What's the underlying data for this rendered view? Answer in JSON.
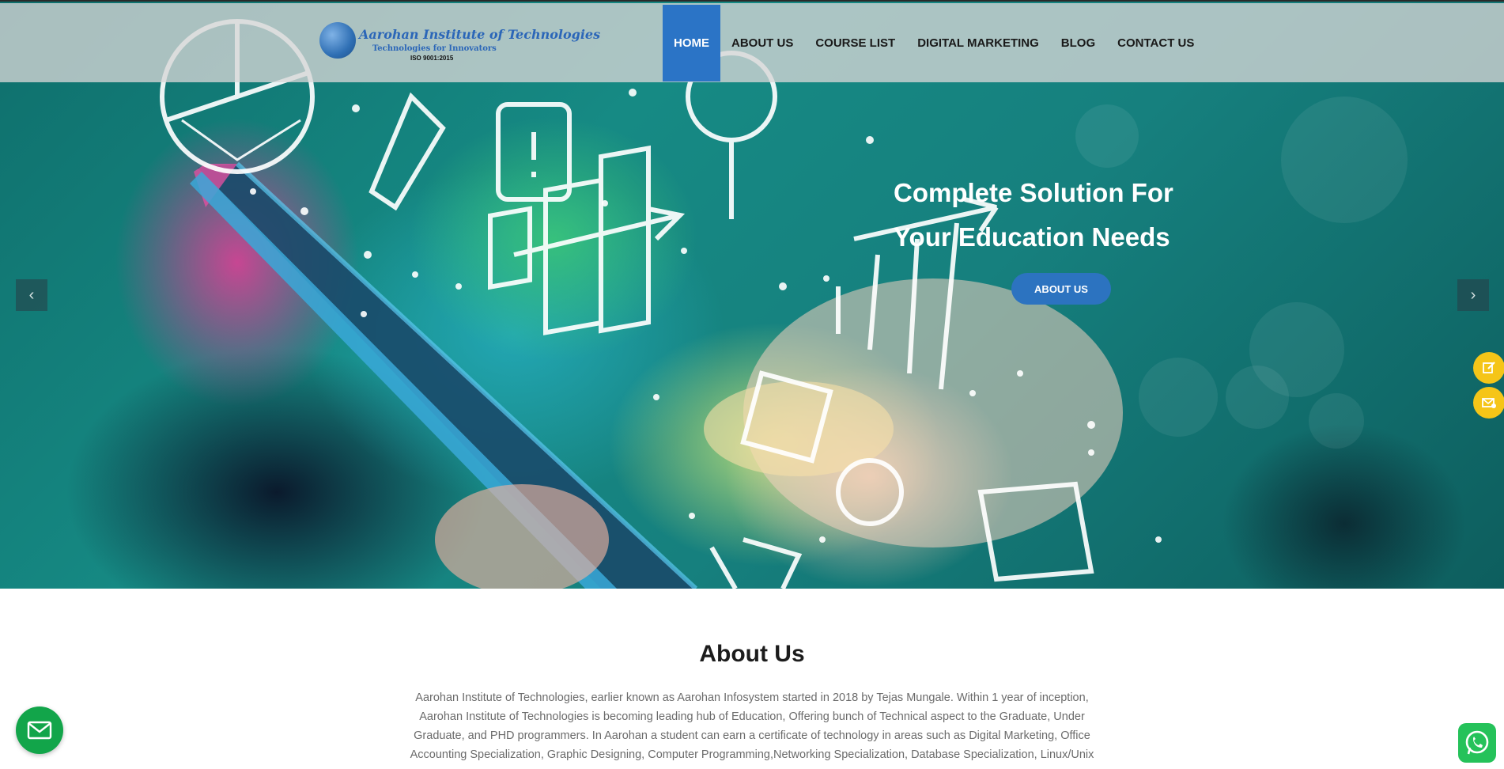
{
  "header": {
    "logo": {
      "title": "Aarohan Institute of Technologies",
      "tagline": "Technologies for Innovators",
      "iso": "ISO 9001:2015"
    },
    "nav": [
      {
        "label": "HOME",
        "active": true
      },
      {
        "label": "ABOUT US",
        "active": false
      },
      {
        "label": "COURSE LIST",
        "active": false
      },
      {
        "label": "DIGITAL MARKETING",
        "active": false
      },
      {
        "label": "BLOG",
        "active": false
      },
      {
        "label": "CONTACT US",
        "active": false
      }
    ]
  },
  "hero": {
    "title_line1": "Complete Solution For",
    "title_line2": "Your Education Needs",
    "button_label": "ABOUT US",
    "prev_icon": "chevron-left-icon",
    "next_icon": "chevron-right-icon"
  },
  "side_actions": [
    {
      "icon": "edit-icon"
    },
    {
      "icon": "mail-icon"
    }
  ],
  "about": {
    "title": "About Us",
    "text": "Aarohan Institute of Technologies, earlier known as Aarohan Infosystem started in 2018 by Tejas Mungale. Within 1 year of inception, Aarohan Institute of Technologies is becoming leading hub of Education, Offering bunch of Technical aspect to the Graduate, Under Graduate, and PHD programmers. In Aarohan a student can earn a certificate of technology in areas such as Digital Marketing, Office Accounting Specialization, Graphic Designing, Computer Programming,Networking Specialization, Database Specialization, Linux/Unix"
  },
  "floating": {
    "mail_icon": "envelope-icon",
    "whatsapp_icon": "whatsapp-icon"
  },
  "colors": {
    "accent": "#2b74c6",
    "side_button": "#f5c518",
    "mail_fab": "#12a54a",
    "whatsapp": "#25c25a"
  }
}
